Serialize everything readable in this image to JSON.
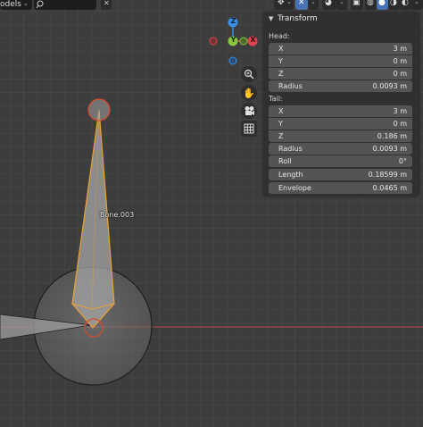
{
  "header": {
    "mode_text": "odels",
    "search_icon": "search-icon"
  },
  "viewport": {
    "bone_label": "Bone.003",
    "gizmo": {
      "z_label": "Z",
      "y_label": "Y",
      "x_label": "X"
    }
  },
  "transform_panel": {
    "title": "Transform",
    "head_label": "Head:",
    "head": [
      {
        "label": "X",
        "value": "3 m"
      },
      {
        "label": "Y",
        "value": "0 m"
      },
      {
        "label": "Z",
        "value": "0 m"
      }
    ],
    "head_radius": {
      "label": "Radius",
      "value": "0.0093 m"
    },
    "tail_label": "Tail:",
    "tail": [
      {
        "label": "X",
        "value": "3 m"
      },
      {
        "label": "Y",
        "value": "0 m"
      },
      {
        "label": "Z",
        "value": "0.186 m"
      }
    ],
    "tail_radius": {
      "label": "Radius",
      "value": "0.0093 m"
    },
    "roll": {
      "label": "Roll",
      "value": "0°"
    },
    "length": {
      "label": "Length",
      "value": "0.18599 m"
    },
    "envelope": {
      "label": "Envelope",
      "value": "0.0465 m"
    }
  },
  "colors": {
    "background": "#3d3d3d",
    "grid": "#4a4a4a",
    "selected_outline": "#f0a030",
    "red_axis": "#c0504d",
    "gizmo_x": "#e0434f",
    "gizmo_y": "#8bc53f",
    "gizmo_z": "#3a8ee6"
  }
}
